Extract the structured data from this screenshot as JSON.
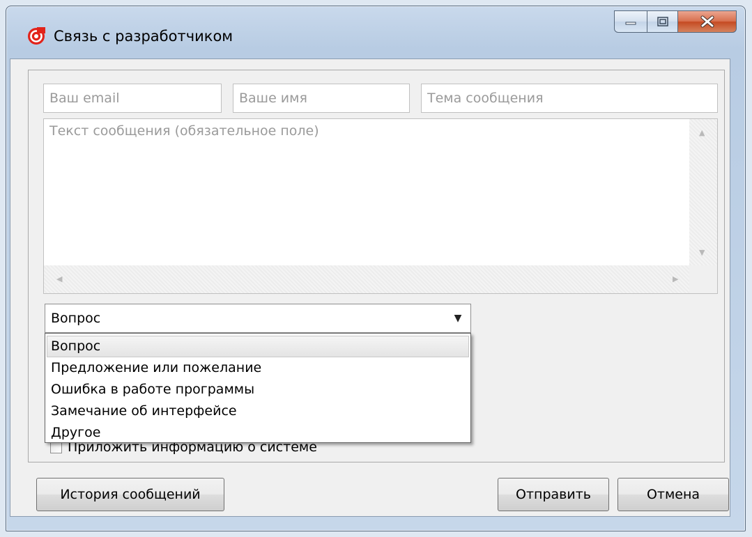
{
  "window": {
    "title": "Связь с разработчиком"
  },
  "form": {
    "email_placeholder": "Ваш email",
    "name_placeholder": "Ваше имя",
    "subject_placeholder": "Тема сообщения",
    "message_placeholder": "Текст сообщения (обязательное поле)",
    "category_selected": "Вопрос",
    "category_options": [
      "Вопрос",
      "Предложение или пожелание",
      "Ошибка в работе программы",
      "Замечание об интерфейсе",
      "Другое"
    ],
    "attach_system_info_label": "Приложить информацию о системе",
    "attach_system_info_checked": false
  },
  "buttons": {
    "history": "История сообщений",
    "send": "Отправить",
    "cancel": "Отмена"
  },
  "icons": {
    "app": "red-circle-logo-icon",
    "minimize": "minimize-icon",
    "maximize": "maximize-icon",
    "close": "close-icon",
    "combo_arrow": "chevron-down-icon"
  },
  "colors": {
    "app_icon_red": "#e2231a",
    "close_button": "#c54a22"
  }
}
